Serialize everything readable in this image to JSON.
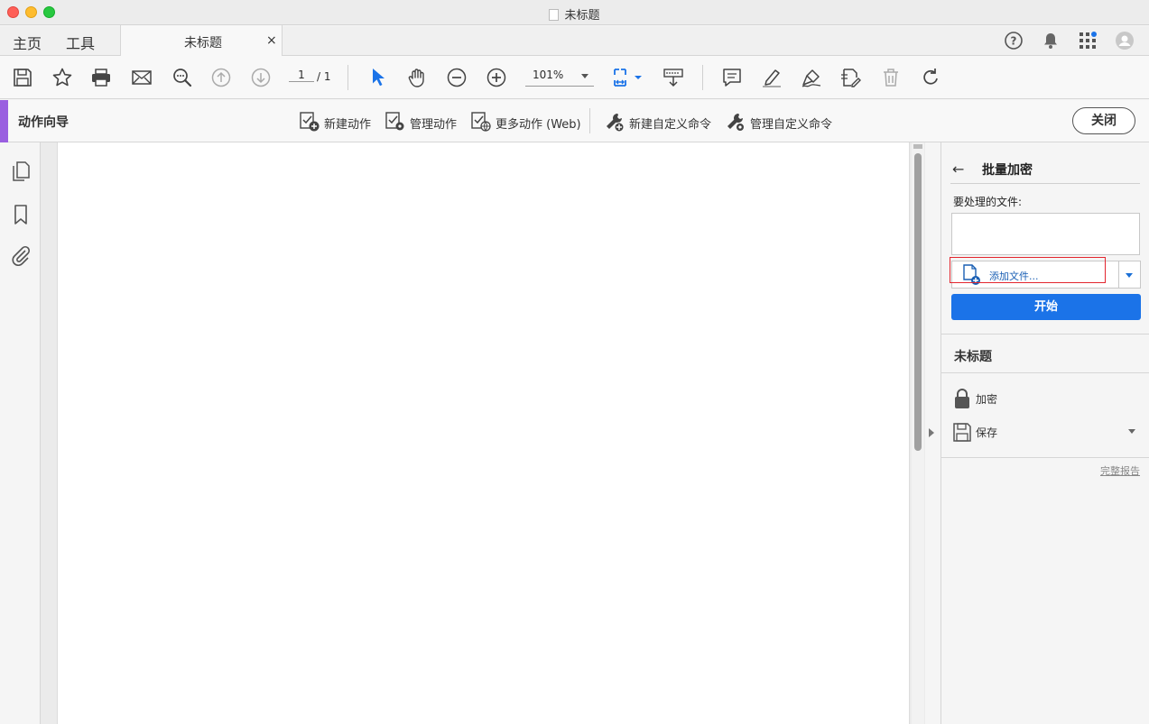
{
  "window": {
    "title": "未标题"
  },
  "tabs": {
    "home": "主页",
    "tools": "工具",
    "doc_tab": "未标题",
    "close_glyph": "×"
  },
  "toolbar": {
    "page_current": "1",
    "page_total": "/ 1",
    "zoom": "101%",
    "icons": [
      "save-icon",
      "bookmark-star-icon",
      "print-icon",
      "mail-icon",
      "search-zoom-icon",
      "page-up-icon",
      "page-down-icon",
      "select-cursor-icon",
      "hand-icon",
      "zoom-out-icon",
      "zoom-in-icon",
      "fit-page-icon",
      "scroll-mode-icon",
      "comment-icon",
      "highlight-icon",
      "sign-icon",
      "edit-doc-icon",
      "trash-icon",
      "rotate-icon"
    ]
  },
  "actionbar": {
    "title": "动作向导",
    "items": [
      {
        "label": "新建动作",
        "icon": "new-action-icon"
      },
      {
        "label": "管理动作",
        "icon": "manage-action-icon"
      },
      {
        "label": "更多动作 (Web)",
        "icon": "web-action-icon"
      },
      {
        "label": "新建自定义命令",
        "icon": "new-command-icon"
      },
      {
        "label": "管理自定义命令",
        "icon": "manage-command-icon"
      }
    ],
    "close": "关闭"
  },
  "panel": {
    "back_glyph": "←",
    "title": "批量加密",
    "files_label": "要处理的文件:",
    "add_files": "添加文件...",
    "start": "开始",
    "doc_name": "未标题",
    "steps": [
      {
        "label": "加密",
        "icon": "lock-icon"
      },
      {
        "label": "保存",
        "icon": "save-icon"
      }
    ],
    "report": "完整报告"
  },
  "colors": {
    "accent": "#9a5fe0",
    "primary": "#1b73e8",
    "highlight": "#e3262f"
  }
}
